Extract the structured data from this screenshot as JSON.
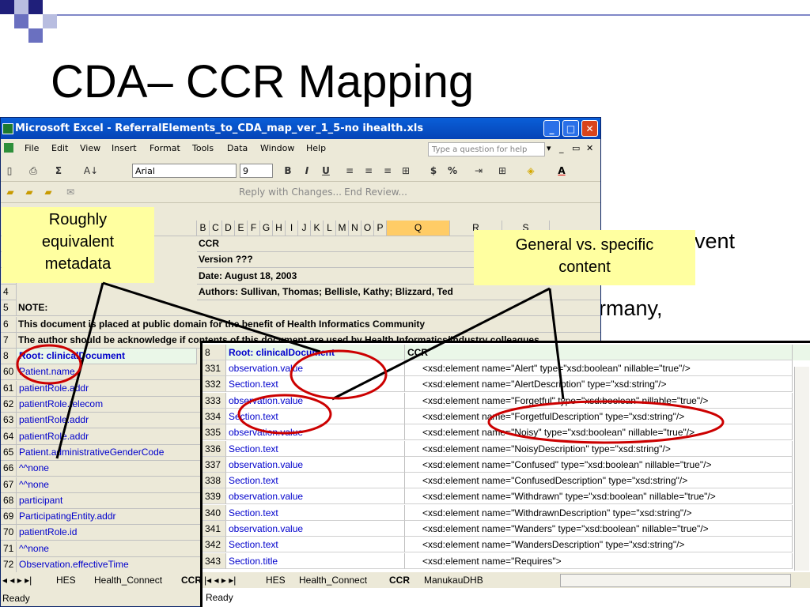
{
  "slide": {
    "title": "CDA– CCR Mapping",
    "bullet_fragment_1": "vent",
    "bullet_fragment_2": "ermany,"
  },
  "excel": {
    "window_title": "Microsoft Excel - ReferralElements_to_CDA_map_ver_1_5-no ihealth.xls",
    "menu": [
      "File",
      "Edit",
      "View",
      "Insert",
      "Format",
      "Tools",
      "Data",
      "Window",
      "Help"
    ],
    "help_placeholder": "Type a question for help",
    "font_name": "Arial",
    "font_size": "9",
    "review_toolbar": {
      "reply": "Reply with Changes...",
      "end_review": "End Review..."
    },
    "column_headers": [
      "B",
      "C",
      "D",
      "E",
      "F",
      "G",
      "H",
      "I",
      "J",
      "K",
      "L",
      "M",
      "N",
      "O",
      "P",
      "Q",
      "R",
      "S"
    ],
    "top_rows": [
      {
        "num": "",
        "text": "CCR"
      },
      {
        "num": "",
        "text": "Version ???"
      },
      {
        "num": "",
        "text": "Date: August 18, 2003"
      },
      {
        "num": "4",
        "text": "Authors:  Sullivan, Thomas; Bellisle, Kathy; Blizzard, Ted"
      },
      {
        "num": "5",
        "text": "NOTE:"
      },
      {
        "num": "6",
        "text": "This document is placed at public domain for the benefit of Health Informatics Community"
      },
      {
        "num": "7",
        "text": "The author should be acknowledge if contents of this document are used by Health Informatics/Industry colleagues"
      }
    ],
    "left_header_row": {
      "num": "8",
      "text": "Root: clinicalDocument",
      "col": "C"
    },
    "left_rows": [
      {
        "num": "60",
        "text": "Patient.name"
      },
      {
        "num": "61",
        "text": "patientRole.addr"
      },
      {
        "num": "62",
        "text": "patientRole.telecom"
      },
      {
        "num": "63",
        "text": "patientRole.addr"
      },
      {
        "num": "64",
        "text": "patientRole.addr"
      },
      {
        "num": "65",
        "text": "Patient.administrativeGenderCode"
      },
      {
        "num": "66",
        "text": "^^none"
      },
      {
        "num": "67",
        "text": "^^none"
      },
      {
        "num": "68",
        "text": "participant"
      },
      {
        "num": "69",
        "text": "ParticipatingEntity.addr"
      },
      {
        "num": "70",
        "text": "patientRole.id"
      },
      {
        "num": "71",
        "text": "^^none"
      },
      {
        "num": "72",
        "text": "Observation.effectiveTime"
      }
    ],
    "sheet_tabs": [
      "HES",
      "Health_Connect",
      "CCR"
    ],
    "status": "Ready"
  },
  "excel2": {
    "header_row": {
      "num": "8",
      "root": "Root: clinicalDocument",
      "ccr": "CCR"
    },
    "rows": [
      {
        "num": "331",
        "cda": "observation.value",
        "ccr": "<xsd:element name=\"Alert\" type=\"xsd:boolean\" nillable=\"true\"/>"
      },
      {
        "num": "332",
        "cda": "Section.text",
        "ccr": "<xsd:element name=\"AlertDescription\" type=\"xsd:string\"/>"
      },
      {
        "num": "333",
        "cda": "observation.value",
        "ccr": "<xsd:element name=\"Forgetful\" type=\"xsd:boolean\" nillable=\"true\"/>"
      },
      {
        "num": "334",
        "cda": "Section.text",
        "ccr": "<xsd:element name=\"ForgetfulDescription\" type=\"xsd:string\"/>"
      },
      {
        "num": "335",
        "cda": "observation.value",
        "ccr": "<xsd:element name=\"Noisy\" type=\"xsd:boolean\" nillable=\"true\"/>"
      },
      {
        "num": "336",
        "cda": "Section.text",
        "ccr": "<xsd:element name=\"NoisyDescription\" type=\"xsd:string\"/>"
      },
      {
        "num": "337",
        "cda": "observation.value",
        "ccr": "<xsd:element name=\"Confused\" type=\"xsd:boolean\" nillable=\"true\"/>"
      },
      {
        "num": "338",
        "cda": "Section.text",
        "ccr": "<xsd:element name=\"ConfusedDescription\" type=\"xsd:string\"/>"
      },
      {
        "num": "339",
        "cda": "observation.value",
        "ccr": "<xsd:element name=\"Withdrawn\" type=\"xsd:boolean\" nillable=\"true\"/>"
      },
      {
        "num": "340",
        "cda": "Section.text",
        "ccr": "<xsd:element name=\"WithdrawnDescription\" type=\"xsd:string\"/>"
      },
      {
        "num": "341",
        "cda": "observation.value",
        "ccr": "<xsd:element name=\"Wanders\" type=\"xsd:boolean\" nillable=\"true\"/>"
      },
      {
        "num": "342",
        "cda": "Section.text",
        "ccr": "<xsd:element name=\"WandersDescription\" type=\"xsd:string\"/>"
      },
      {
        "num": "343",
        "cda": "Section.title",
        "ccr": "<xsd:element name=\"Requires\">"
      }
    ],
    "sheet_tabs": [
      "HES",
      "Health_Connect",
      "CCR",
      "ManukauDHB"
    ],
    "status": "Ready"
  },
  "callouts": {
    "left": "Roughly equivalent metadata",
    "right": "General vs. specific content"
  },
  "colors": {
    "title_blue": "#0543b6",
    "callout": "#ffffa0",
    "ellipse": "#cc0000",
    "slide_square": "#2a2a8c"
  }
}
